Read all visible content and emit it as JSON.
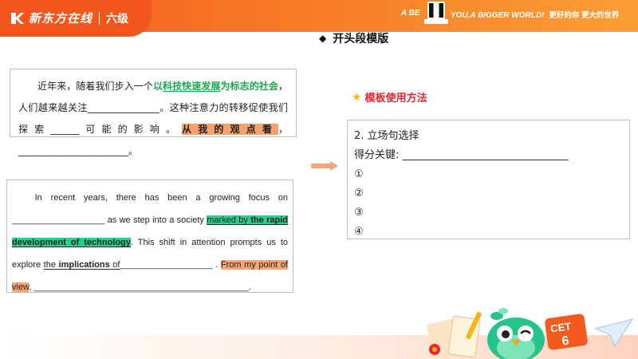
{
  "header": {
    "brand": "新东方在线",
    "level": "六级",
    "slogan_left": "A BE",
    "slogan_right": "YOU,A BIGGER WORLD!",
    "slogan_cn": "更好的你 更大的世界"
  },
  "title": "开头段模版",
  "chinese_template": {
    "s1_a": "近年来，随着我们步入一个",
    "s1_b": "以",
    "s1_c": "科技快速发展",
    "s1_d": "为标志的社会",
    "s1_e": "，人们越来越关注",
    "blank1": "_______________",
    "s2": "。这种注意力的转移促使我们探索",
    "blank2": "______",
    "s3": "可能的影响。",
    "s4": "从我的观点看",
    "s5": "，",
    "blank3": "_______________________",
    "s6": "。"
  },
  "english_template": {
    "p1": "In recent years, there has been a growing focus on ",
    "blank1": "___________________",
    "p2": " as we step into a society ",
    "h1": "marked by ",
    "h2": "the rapid development of technology",
    "p3": ". This shift in attention prompts us to explore ",
    "u1": "the ",
    "u2": "implications",
    "u3": " of",
    "blank2": "___________________",
    "p4": " . ",
    "h3": "From my point of view",
    "p5": ", ",
    "blank3": "____________________________________________",
    "p6": "."
  },
  "method": {
    "heading": "模板使用方法"
  },
  "right_box": {
    "line1": "2. 立场句选择",
    "line2_label": "得分关键: ",
    "line2_blank": "________________________________",
    "items": [
      "①",
      "②",
      "③",
      "④"
    ]
  },
  "colors": {
    "header_orange": "#f25a1e",
    "green_text": "#1aa84b",
    "green_highlight": "#2fcc8c",
    "orange_highlight": "#f5a16b",
    "method_red": "#e8262f"
  },
  "icons": {
    "logo": "koo-logo-icon",
    "diamond": "diamond-bullet-icon",
    "star": "star-icon",
    "arrow": "right-arrow-icon",
    "mascot": "parrot-mascot-icon"
  }
}
